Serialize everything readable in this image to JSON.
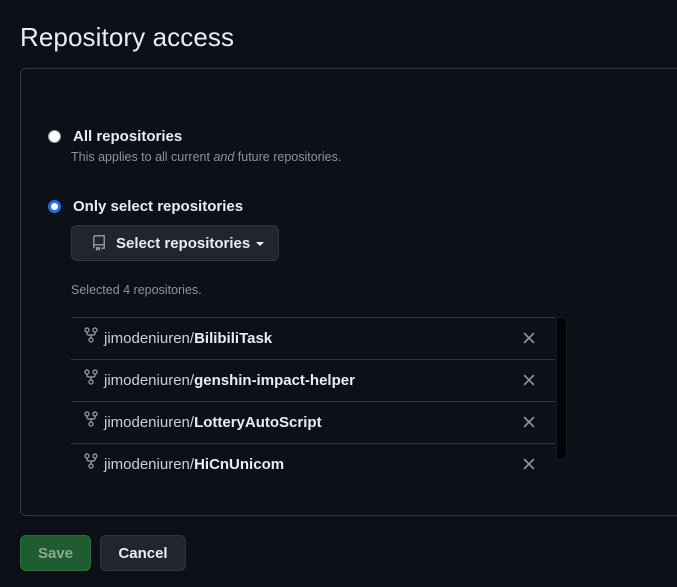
{
  "page": {
    "title": "Repository access"
  },
  "access": {
    "all": {
      "label": "All repositories",
      "note_pre": "This applies to all current ",
      "note_em": "and",
      "note_post": " future repositories.",
      "selected": false
    },
    "select": {
      "label": "Only select repositories",
      "selected": true
    },
    "select_button_label": "Select repositories",
    "selected_count_text": "Selected 4 repositories."
  },
  "repositories": [
    {
      "owner": "jimodeniuren/",
      "name": "BilibiliTask"
    },
    {
      "owner": "jimodeniuren/",
      "name": "genshin-impact-helper"
    },
    {
      "owner": "jimodeniuren/",
      "name": "LotteryAutoScript"
    },
    {
      "owner": "jimodeniuren/",
      "name": "HiCnUnicom"
    }
  ],
  "actions": {
    "save_label": "Save",
    "cancel_label": "Cancel"
  },
  "colors": {
    "background": "#0d1117",
    "border": "#30363d",
    "accent_radio": "#1f6feb",
    "save_bg": "#1f5d31",
    "muted_text": "#8b949e"
  },
  "icons": {
    "select_button": "repo-icon",
    "repo_item": "repo-forked-icon",
    "remove": "x-icon"
  }
}
